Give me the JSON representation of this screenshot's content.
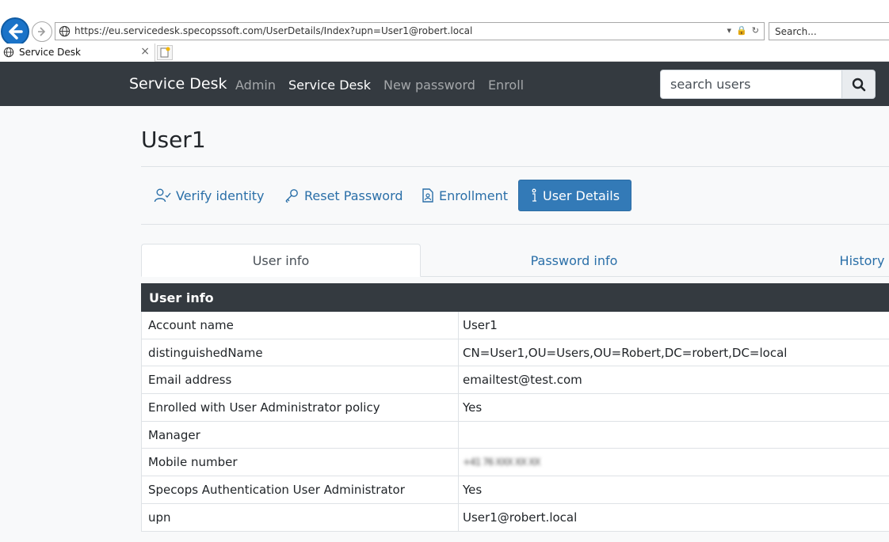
{
  "browser": {
    "url": "https://eu.servicedesk.specopssoft.com/UserDetails/Index?upn=User1@robert.local",
    "search_placeholder": "Search...",
    "tab_title": "Service Desk"
  },
  "navbar": {
    "brand": "Service Desk",
    "links": [
      {
        "label": "Admin"
      },
      {
        "label": "Service Desk"
      },
      {
        "label": "New password"
      },
      {
        "label": "Enroll"
      }
    ],
    "search_placeholder": "search users"
  },
  "page": {
    "title": "User1"
  },
  "actions": [
    {
      "label": "Verify identity",
      "icon": "user-check-icon"
    },
    {
      "label": "Reset Password",
      "icon": "key-icon"
    },
    {
      "label": "Enrollment",
      "icon": "document-user-icon"
    },
    {
      "label": "User Details",
      "icon": "info-icon"
    }
  ],
  "tabs": [
    {
      "label": "User info"
    },
    {
      "label": "Password info"
    },
    {
      "label": "History"
    }
  ],
  "user_info": {
    "header": "User info",
    "rows": [
      {
        "key": "Account name",
        "value": "User1"
      },
      {
        "key": "distinguishedName",
        "value": "CN=User1,OU=Users,OU=Robert,DC=robert,DC=local"
      },
      {
        "key": "Email address",
        "value": "emailtest@test.com"
      },
      {
        "key": "Enrolled with User Administrator policy",
        "value": "Yes"
      },
      {
        "key": "Manager",
        "value": ""
      },
      {
        "key": "Mobile number",
        "value": "+41 76 XXX XX XX"
      },
      {
        "key": "Specops Authentication User Administrator",
        "value": "Yes"
      },
      {
        "key": "upn",
        "value": "User1@robert.local"
      }
    ]
  },
  "colors": {
    "navbar_bg": "#343a40",
    "accent": "#337ab7",
    "link": "#2a6fa8"
  }
}
